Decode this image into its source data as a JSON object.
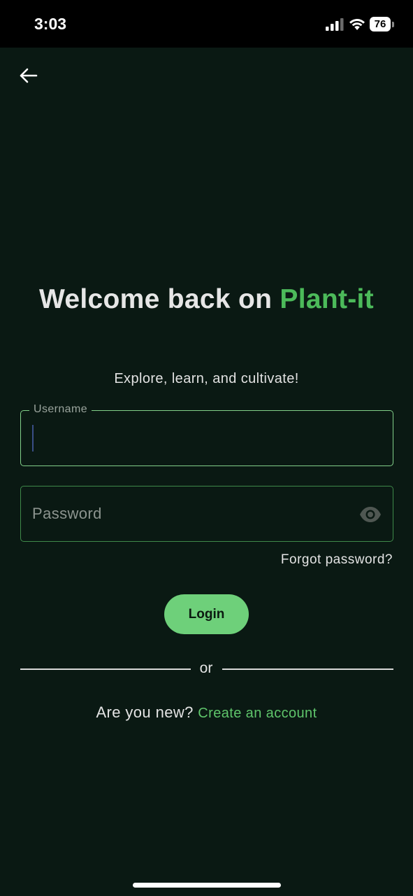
{
  "status_bar": {
    "time": "3:03",
    "battery": "76"
  },
  "colors": {
    "background": "#0a1913",
    "brand_green": "#4cba5a",
    "button_green": "#6ed07a",
    "link_green": "#5fc56b",
    "field_border": "#3f8a4a"
  },
  "nav": {
    "back_icon": "arrow-left-icon"
  },
  "header": {
    "title_prefix": "Welcome back on ",
    "title_brand": "Plant-it",
    "subtitle": "Explore, learn, and cultivate!"
  },
  "form": {
    "username": {
      "label": "Username",
      "value": ""
    },
    "password": {
      "placeholder": "Password",
      "value": "",
      "toggle_icon": "eye-icon"
    },
    "forgot_label": "Forgot password?",
    "login_label": "Login"
  },
  "divider": {
    "label": "or"
  },
  "signup": {
    "question": "Are you new?",
    "link_label": "Create an account"
  }
}
